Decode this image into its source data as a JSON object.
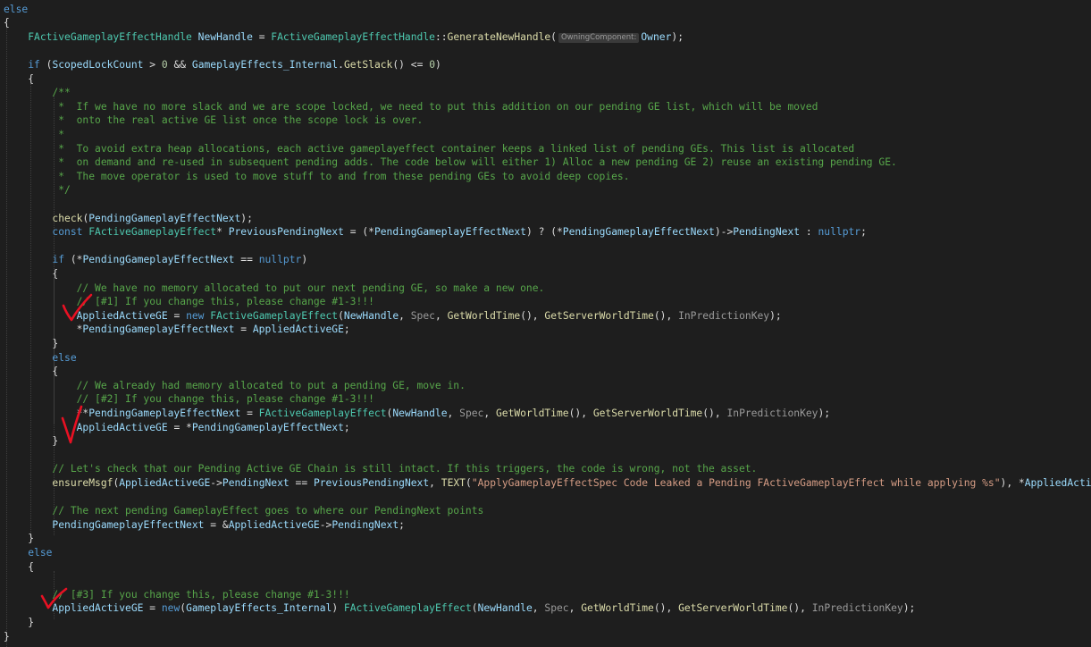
{
  "colors": {
    "background": "#1e1e1e",
    "text": "#dcdcdc",
    "keyword": "#569cd6",
    "type": "#4ec9b0",
    "function": "#dcdcaa",
    "variable": "#9cdcfe",
    "comment": "#57a64a",
    "string": "#d69d85",
    "param": "#9a9a9a",
    "number": "#b5cea8",
    "handwritten_check": "#e81123"
  },
  "code_lines": [
    [
      {
        "t": "else",
        "c": "keyword"
      }
    ],
    [
      {
        "t": "{",
        "c": "text"
      }
    ],
    [
      {
        "t": "    ",
        "c": "text"
      },
      {
        "t": "FActiveGameplayEffectHandle",
        "c": "type"
      },
      {
        "t": " ",
        "c": "text"
      },
      {
        "t": "NewHandle",
        "c": "variable"
      },
      {
        "t": " = ",
        "c": "text"
      },
      {
        "t": "FActiveGameplayEffectHandle",
        "c": "type"
      },
      {
        "t": "::",
        "c": "text"
      },
      {
        "t": "GenerateNewHandle",
        "c": "function"
      },
      {
        "t": "(",
        "c": "text"
      },
      {
        "t": "OwningComponent:",
        "c": "hint"
      },
      {
        "t": "Owner",
        "c": "variable"
      },
      {
        "t": ");",
        "c": "text"
      }
    ],
    [],
    [
      {
        "t": "    ",
        "c": "text"
      },
      {
        "t": "if",
        "c": "keyword"
      },
      {
        "t": " (",
        "c": "text"
      },
      {
        "t": "ScopedLockCount",
        "c": "variable"
      },
      {
        "t": " > ",
        "c": "text"
      },
      {
        "t": "0",
        "c": "number"
      },
      {
        "t": " && ",
        "c": "text"
      },
      {
        "t": "GameplayEffects_Internal",
        "c": "variable"
      },
      {
        "t": ".",
        "c": "text"
      },
      {
        "t": "GetSlack",
        "c": "function"
      },
      {
        "t": "() <= ",
        "c": "text"
      },
      {
        "t": "0",
        "c": "number"
      },
      {
        "t": ")",
        "c": "text"
      }
    ],
    [
      {
        "t": "    {",
        "c": "text"
      }
    ],
    [
      {
        "t": "        /**",
        "c": "comment"
      }
    ],
    [
      {
        "t": "         *  If we have no more slack and we are scope locked, we need to put this addition on our pending GE list, which will be moved",
        "c": "comment"
      }
    ],
    [
      {
        "t": "         *  onto the real active GE list once the scope lock is over.",
        "c": "comment"
      }
    ],
    [
      {
        "t": "         *",
        "c": "comment"
      }
    ],
    [
      {
        "t": "         *  To avoid extra heap allocations, each active gameplayeffect container keeps a linked list of pending GEs. This list is allocated",
        "c": "comment"
      }
    ],
    [
      {
        "t": "         *  on demand and re-used in subsequent pending adds. The code below will either 1) Alloc a new pending GE 2) reuse an existing pending GE.",
        "c": "comment"
      }
    ],
    [
      {
        "t": "         *  The move operator is used to move stuff to and from these pending GEs to avoid deep copies.",
        "c": "comment"
      }
    ],
    [
      {
        "t": "         */",
        "c": "comment"
      }
    ],
    [],
    [
      {
        "t": "        ",
        "c": "text"
      },
      {
        "t": "check",
        "c": "function"
      },
      {
        "t": "(",
        "c": "text"
      },
      {
        "t": "PendingGameplayEffectNext",
        "c": "variable"
      },
      {
        "t": ");",
        "c": "text"
      }
    ],
    [
      {
        "t": "        ",
        "c": "text"
      },
      {
        "t": "const",
        "c": "keyword"
      },
      {
        "t": " ",
        "c": "text"
      },
      {
        "t": "FActiveGameplayEffect",
        "c": "type"
      },
      {
        "t": "* ",
        "c": "text"
      },
      {
        "t": "PreviousPendingNext",
        "c": "variable"
      },
      {
        "t": " = (*",
        "c": "text"
      },
      {
        "t": "PendingGameplayEffectNext",
        "c": "variable"
      },
      {
        "t": ") ? (*",
        "c": "text"
      },
      {
        "t": "PendingGameplayEffectNext",
        "c": "variable"
      },
      {
        "t": ")->",
        "c": "text"
      },
      {
        "t": "PendingNext",
        "c": "variable"
      },
      {
        "t": " : ",
        "c": "text"
      },
      {
        "t": "nullptr",
        "c": "keyword"
      },
      {
        "t": ";",
        "c": "text"
      }
    ],
    [],
    [
      {
        "t": "        ",
        "c": "text"
      },
      {
        "t": "if",
        "c": "keyword"
      },
      {
        "t": " (*",
        "c": "text"
      },
      {
        "t": "PendingGameplayEffectNext",
        "c": "variable"
      },
      {
        "t": " == ",
        "c": "text"
      },
      {
        "t": "nullptr",
        "c": "keyword"
      },
      {
        "t": ")",
        "c": "text"
      }
    ],
    [
      {
        "t": "        {",
        "c": "text"
      }
    ],
    [
      {
        "t": "            // We have no memory allocated to put our next pending GE, so make a new one.",
        "c": "comment"
      }
    ],
    [
      {
        "t": "            // [#1] If you change this, please change #1-3!!!",
        "c": "comment"
      }
    ],
    [
      {
        "t": "            ",
        "c": "text"
      },
      {
        "t": "AppliedActiveGE",
        "c": "variable"
      },
      {
        "t": " = ",
        "c": "text"
      },
      {
        "t": "new",
        "c": "keyword"
      },
      {
        "t": " ",
        "c": "text"
      },
      {
        "t": "FActiveGameplayEffect",
        "c": "type"
      },
      {
        "t": "(",
        "c": "text"
      },
      {
        "t": "NewHandle",
        "c": "variable"
      },
      {
        "t": ", ",
        "c": "text"
      },
      {
        "t": "Spec",
        "c": "param"
      },
      {
        "t": ", ",
        "c": "text"
      },
      {
        "t": "GetWorldTime",
        "c": "function"
      },
      {
        "t": "(), ",
        "c": "text"
      },
      {
        "t": "GetServerWorldTime",
        "c": "function"
      },
      {
        "t": "(), ",
        "c": "text"
      },
      {
        "t": "InPredictionKey",
        "c": "param"
      },
      {
        "t": ");",
        "c": "text"
      }
    ],
    [
      {
        "t": "            *",
        "c": "text"
      },
      {
        "t": "PendingGameplayEffectNext",
        "c": "variable"
      },
      {
        "t": " = ",
        "c": "text"
      },
      {
        "t": "AppliedActiveGE",
        "c": "variable"
      },
      {
        "t": ";",
        "c": "text"
      }
    ],
    [
      {
        "t": "        }",
        "c": "text"
      }
    ],
    [
      {
        "t": "        ",
        "c": "text"
      },
      {
        "t": "else",
        "c": "keyword"
      }
    ],
    [
      {
        "t": "        {",
        "c": "text"
      }
    ],
    [
      {
        "t": "            // We already had memory allocated to put a pending GE, move in.",
        "c": "comment"
      }
    ],
    [
      {
        "t": "            // [#2] If you change this, please change #1-3!!!",
        "c": "comment"
      }
    ],
    [
      {
        "t": "            **",
        "c": "text"
      },
      {
        "t": "PendingGameplayEffectNext",
        "c": "variable"
      },
      {
        "t": " = ",
        "c": "text"
      },
      {
        "t": "FActiveGameplayEffect",
        "c": "type"
      },
      {
        "t": "(",
        "c": "text"
      },
      {
        "t": "NewHandle",
        "c": "variable"
      },
      {
        "t": ", ",
        "c": "text"
      },
      {
        "t": "Spec",
        "c": "param"
      },
      {
        "t": ", ",
        "c": "text"
      },
      {
        "t": "GetWorldTime",
        "c": "function"
      },
      {
        "t": "(), ",
        "c": "text"
      },
      {
        "t": "GetServerWorldTime",
        "c": "function"
      },
      {
        "t": "(), ",
        "c": "text"
      },
      {
        "t": "InPredictionKey",
        "c": "param"
      },
      {
        "t": ");",
        "c": "text"
      }
    ],
    [
      {
        "t": "            ",
        "c": "text"
      },
      {
        "t": "AppliedActiveGE",
        "c": "variable"
      },
      {
        "t": " = *",
        "c": "text"
      },
      {
        "t": "PendingGameplayEffectNext",
        "c": "variable"
      },
      {
        "t": ";",
        "c": "text"
      }
    ],
    [
      {
        "t": "        }",
        "c": "text"
      }
    ],
    [],
    [
      {
        "t": "        // Let's check that our Pending Active GE Chain is still intact. If this triggers, the code is wrong, not the asset.",
        "c": "comment"
      }
    ],
    [
      {
        "t": "        ",
        "c": "text"
      },
      {
        "t": "ensureMsgf",
        "c": "function"
      },
      {
        "t": "(",
        "c": "text"
      },
      {
        "t": "AppliedActiveGE",
        "c": "variable"
      },
      {
        "t": "->",
        "c": "text"
      },
      {
        "t": "PendingNext",
        "c": "variable"
      },
      {
        "t": " == ",
        "c": "text"
      },
      {
        "t": "PreviousPendingNext",
        "c": "variable"
      },
      {
        "t": ", ",
        "c": "text"
      },
      {
        "t": "TEXT",
        "c": "function"
      },
      {
        "t": "(",
        "c": "text"
      },
      {
        "t": "\"ApplyGameplayEffectSpec Code Leaked a Pending FActiveGameplayEffect while applying %s\"",
        "c": "string"
      },
      {
        "t": "), *",
        "c": "text"
      },
      {
        "t": "AppliedActi",
        "c": "variable"
      }
    ],
    [],
    [
      {
        "t": "        // The next pending GameplayEffect goes to where our PendingNext points",
        "c": "comment"
      }
    ],
    [
      {
        "t": "        ",
        "c": "text"
      },
      {
        "t": "PendingGameplayEffectNext",
        "c": "variable"
      },
      {
        "t": " = &",
        "c": "text"
      },
      {
        "t": "AppliedActiveGE",
        "c": "variable"
      },
      {
        "t": "->",
        "c": "text"
      },
      {
        "t": "PendingNext",
        "c": "variable"
      },
      {
        "t": ";",
        "c": "text"
      }
    ],
    [
      {
        "t": "    }",
        "c": "text"
      }
    ],
    [
      {
        "t": "    ",
        "c": "text"
      },
      {
        "t": "else",
        "c": "keyword"
      }
    ],
    [
      {
        "t": "    {",
        "c": "text"
      }
    ],
    [],
    [
      {
        "t": "        // [#3] If you change this, please change #1-3!!!",
        "c": "comment"
      }
    ],
    [
      {
        "t": "        ",
        "c": "text"
      },
      {
        "t": "AppliedActiveGE",
        "c": "variable"
      },
      {
        "t": " = ",
        "c": "text"
      },
      {
        "t": "new",
        "c": "keyword"
      },
      {
        "t": "(",
        "c": "text"
      },
      {
        "t": "GameplayEffects_Internal",
        "c": "variable"
      },
      {
        "t": ") ",
        "c": "text"
      },
      {
        "t": "FActiveGameplayEffect",
        "c": "type"
      },
      {
        "t": "(",
        "c": "text"
      },
      {
        "t": "NewHandle",
        "c": "variable"
      },
      {
        "t": ", ",
        "c": "text"
      },
      {
        "t": "Spec",
        "c": "param"
      },
      {
        "t": ", ",
        "c": "text"
      },
      {
        "t": "GetWorldTime",
        "c": "function"
      },
      {
        "t": "(), ",
        "c": "text"
      },
      {
        "t": "GetServerWorldTime",
        "c": "function"
      },
      {
        "t": "(), ",
        "c": "text"
      },
      {
        "t": "InPredictionKey",
        "c": "param"
      },
      {
        "t": ");",
        "c": "text"
      }
    ],
    [
      {
        "t": "    }",
        "c": "text"
      }
    ],
    [
      {
        "t": "}",
        "c": "text"
      }
    ]
  ]
}
